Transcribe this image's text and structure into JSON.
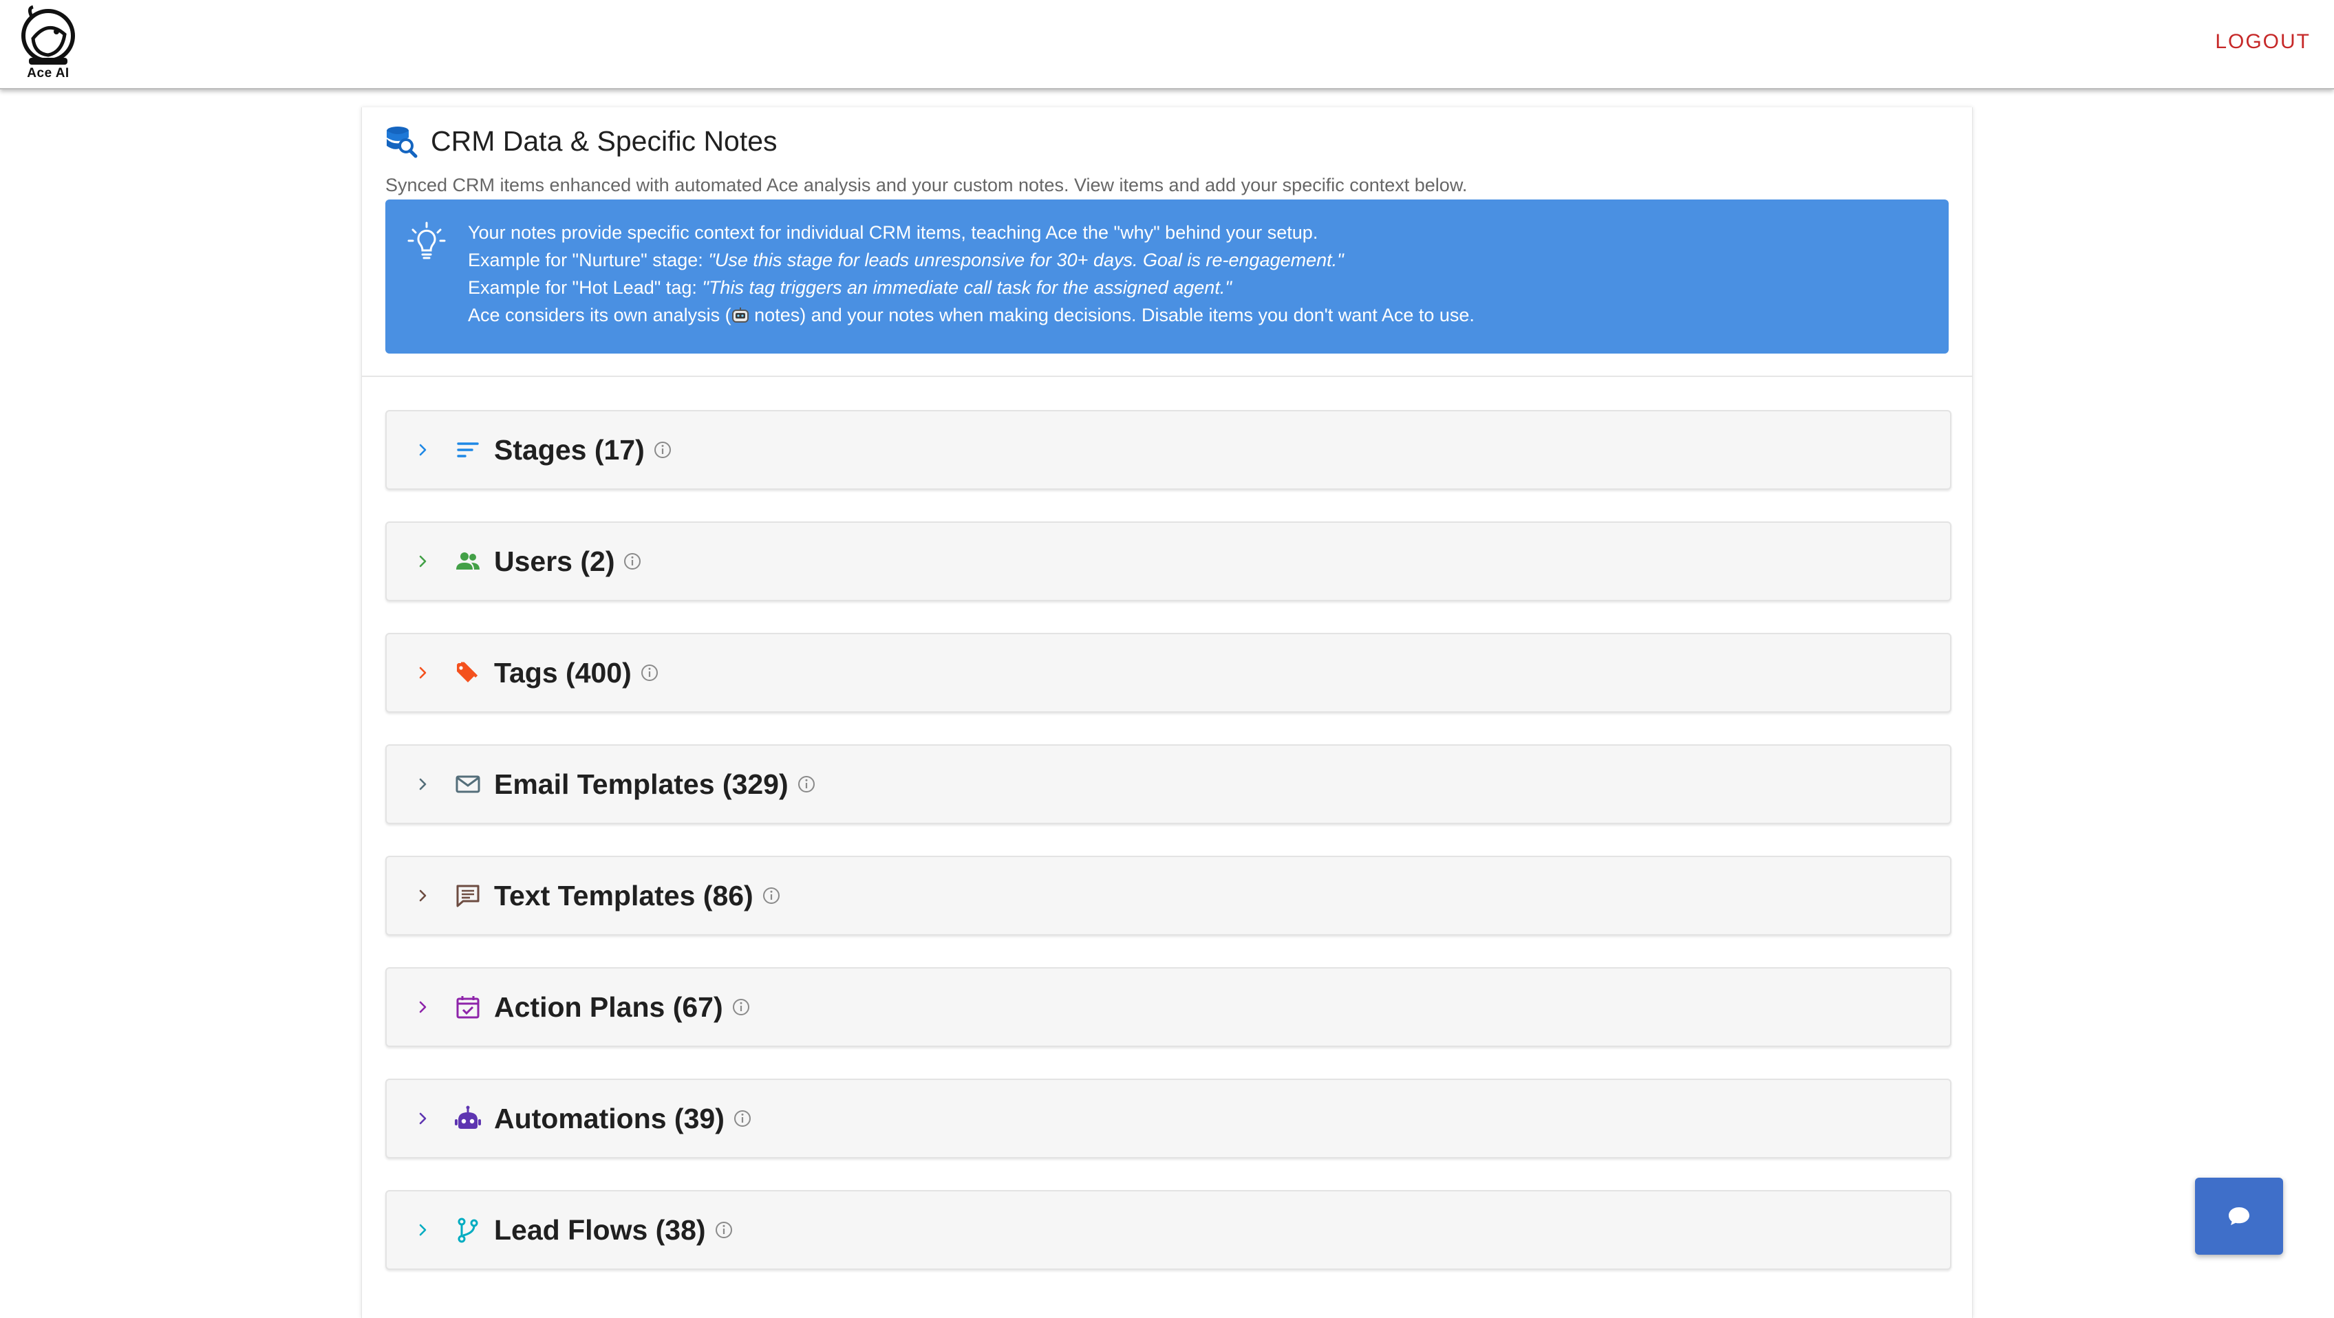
{
  "app": {
    "logo_text": "Ace AI",
    "logout_label": "LOGOUT"
  },
  "page": {
    "title": "CRM Data & Specific Notes",
    "subtitle": "Synced CRM items enhanced with automated Ace analysis and your custom notes. View items and add your specific context below."
  },
  "info_box": {
    "line1": "Your notes provide specific context for individual CRM items, teaching Ace the \"why\" behind your setup.",
    "line2_prefix": "Example for \"Nurture\" stage: ",
    "line2_quote": "\"Use this stage for leads unresponsive for 30+ days. Goal is re-engagement.\"",
    "line3_prefix": "Example for \"Hot Lead\" tag: ",
    "line3_quote": "\"This tag triggers an immediate call task for the assigned agent.\"",
    "line4_prefix": "Ace considers its own analysis (",
    "line4_suffix": " notes) and your notes when making decisions. Disable items you don't want Ace to use."
  },
  "sections": [
    {
      "label": "Stages (17)",
      "icon": "stages-sort-icon",
      "color": "#1e88e5"
    },
    {
      "label": "Users (2)",
      "icon": "users-group-icon",
      "color": "#43a047"
    },
    {
      "label": "Tags (400)",
      "icon": "tag-icon",
      "color": "#f4511e"
    },
    {
      "label": "Email Templates (329)",
      "icon": "envelope-icon",
      "color": "#546e7a"
    },
    {
      "label": "Text Templates (86)",
      "icon": "chat-bubble-icon",
      "color": "#6d4c41"
    },
    {
      "label": "Action Plans (67)",
      "icon": "calendar-check-icon",
      "color": "#8e24aa"
    },
    {
      "label": "Automations (39)",
      "icon": "robot-icon",
      "color": "#5e35b1"
    },
    {
      "label": "Lead Flows (38)",
      "icon": "flow-branch-icon",
      "color": "#00acc1"
    }
  ],
  "colors": {
    "info_bg": "#4a90e2",
    "logout": "#c62828",
    "chat_button": "#3f6fc9"
  }
}
